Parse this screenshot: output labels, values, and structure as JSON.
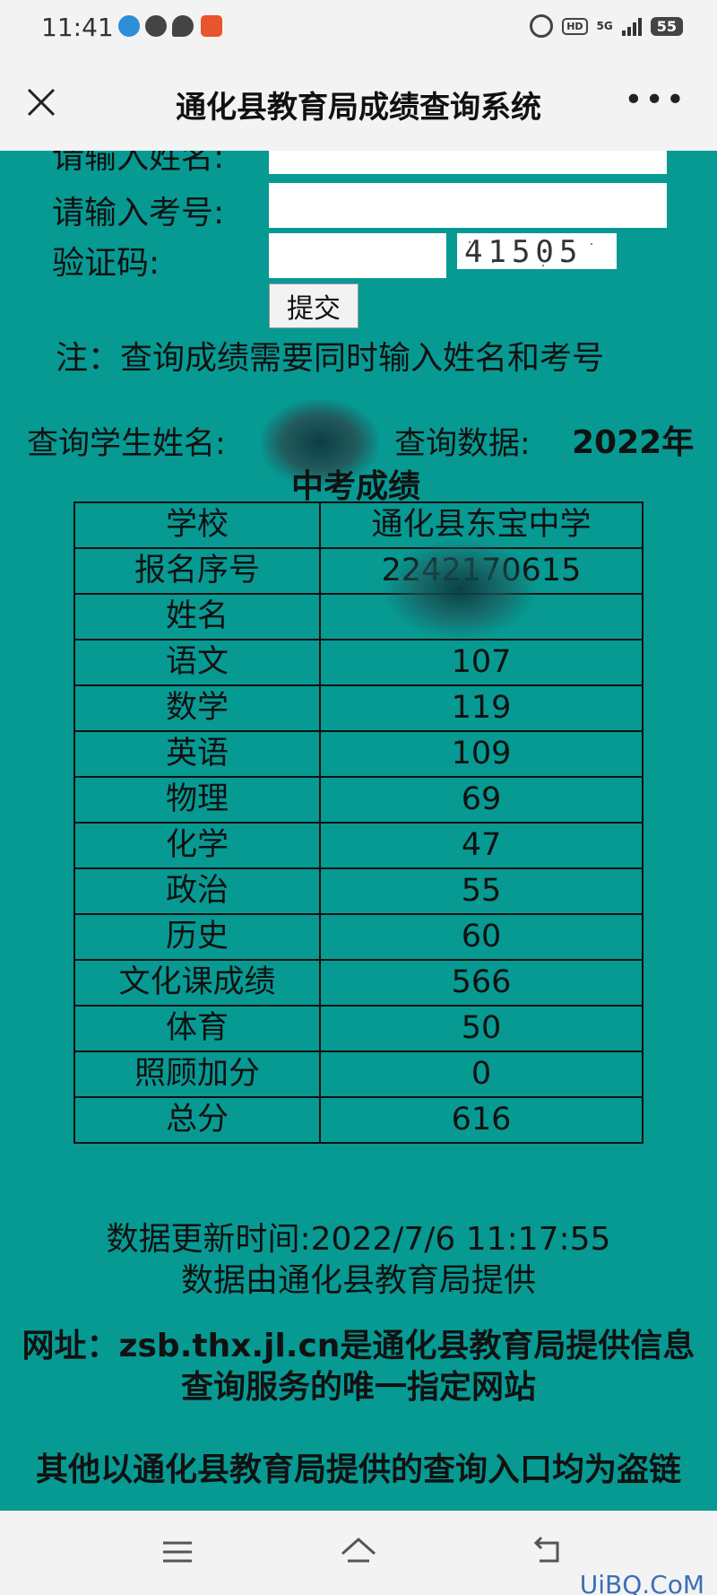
{
  "status_bar": {
    "time": "11:41",
    "battery": "55",
    "hd": "HD",
    "network": "5G"
  },
  "title_bar": {
    "title": "通化县教育局成绩查询系统"
  },
  "form": {
    "name_label": "请输入姓名:",
    "exam_no_label": "请输入考号:",
    "captcha_label": "验证码:",
    "captcha_text": "41505",
    "submit_label": "提交",
    "note": "注：查询成绩需要同时输入姓名和考号"
  },
  "query": {
    "student_label": "查询学生姓名:",
    "data_label": "查询数据:",
    "data_value_line1": "2022年",
    "data_value_line2": "中考成绩"
  },
  "scores": [
    {
      "key": "学校",
      "value": "通化县东宝中学"
    },
    {
      "key": "报名序号",
      "value": "2242170615"
    },
    {
      "key": "姓名",
      "value": ""
    },
    {
      "key": "语文",
      "value": "107"
    },
    {
      "key": "数学",
      "value": "119"
    },
    {
      "key": "英语",
      "value": "109"
    },
    {
      "key": "物理",
      "value": "69"
    },
    {
      "key": "化学",
      "value": "47"
    },
    {
      "key": "政治",
      "value": "55"
    },
    {
      "key": "历史",
      "value": "60"
    },
    {
      "key": "文化课成绩",
      "value": "566"
    },
    {
      "key": "体育",
      "value": "50"
    },
    {
      "key": "照顾加分",
      "value": "0"
    },
    {
      "key": "总分",
      "value": "616"
    }
  ],
  "footer": {
    "update_time": "数据更新时间:2022/7/6 11:17:55",
    "provider": "数据由通化县教育局提供",
    "site_notice": "网址：zsb.thx.jl.cn是通化县教育局提供信息查询服务的唯一指定网站",
    "warning": "其他以通化县教育局提供的查询入口均为盗链"
  },
  "watermark": "UiBQ.CoM"
}
